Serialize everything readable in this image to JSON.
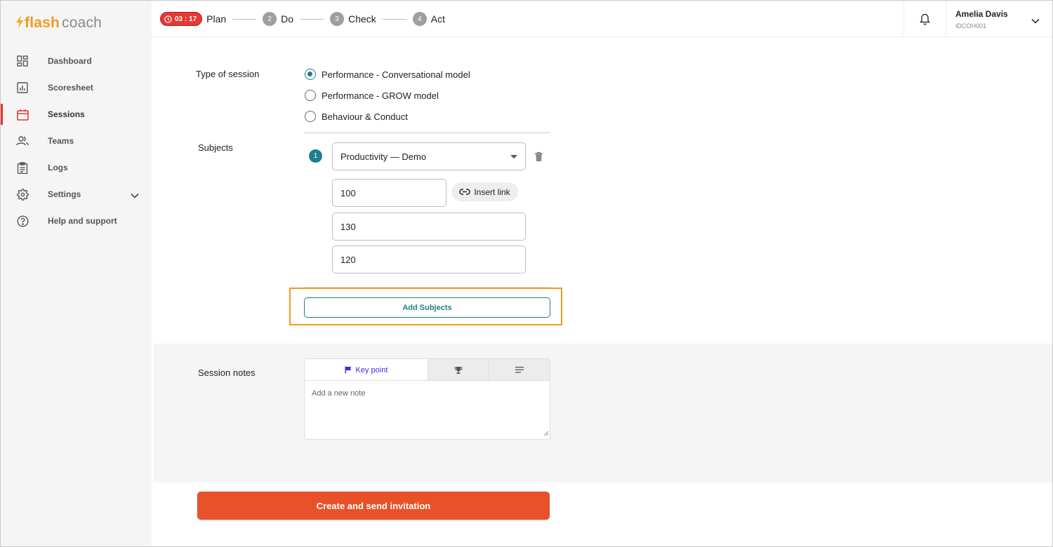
{
  "logo": {
    "flash": "flash",
    "coach": "coach"
  },
  "sidebar": {
    "items": [
      {
        "label": "Dashboard",
        "icon": "dashboard-icon"
      },
      {
        "label": "Scoresheet",
        "icon": "bar-chart-icon"
      },
      {
        "label": "Sessions",
        "icon": "calendar-icon",
        "active": true
      },
      {
        "label": "Teams",
        "icon": "people-icon"
      },
      {
        "label": "Logs",
        "icon": "clipboard-icon"
      },
      {
        "label": "Settings",
        "icon": "gear-icon",
        "has_chevron": true
      },
      {
        "label": "Help and support",
        "icon": "help-circle-icon"
      }
    ]
  },
  "header": {
    "timer": "03 : 17",
    "steps": [
      {
        "label": "Plan"
      },
      {
        "num": "2",
        "label": "Do"
      },
      {
        "num": "3",
        "label": "Check"
      },
      {
        "num": "4",
        "label": "Act"
      }
    ],
    "user": {
      "name": "Amelia Davis",
      "id": "IDCOH001"
    }
  },
  "form": {
    "session_type_label": "Type of session",
    "session_types": [
      {
        "label": "Performance - Conversational model",
        "checked": true
      },
      {
        "label": "Performance - GROW model",
        "checked": false
      },
      {
        "label": "Behaviour & Conduct",
        "checked": false
      }
    ],
    "subjects_label": "Subjects",
    "subject_index": "1",
    "subject_select": "Productivity — Demo",
    "insert_link": "Insert link",
    "values": [
      "100",
      "130",
      "120"
    ],
    "add_subjects": "Add Subjects"
  },
  "notes": {
    "label": "Session notes",
    "tab_active": "Key point",
    "placeholder": "Add a new note"
  },
  "cta": "Create and send invitation",
  "colors": {
    "accent_teal": "#1f7d8c",
    "brand_orange": "#f39a1f",
    "cta_orange": "#e8512a",
    "active_red": "#e2362e",
    "key_point_blue": "#3b2fd6"
  }
}
